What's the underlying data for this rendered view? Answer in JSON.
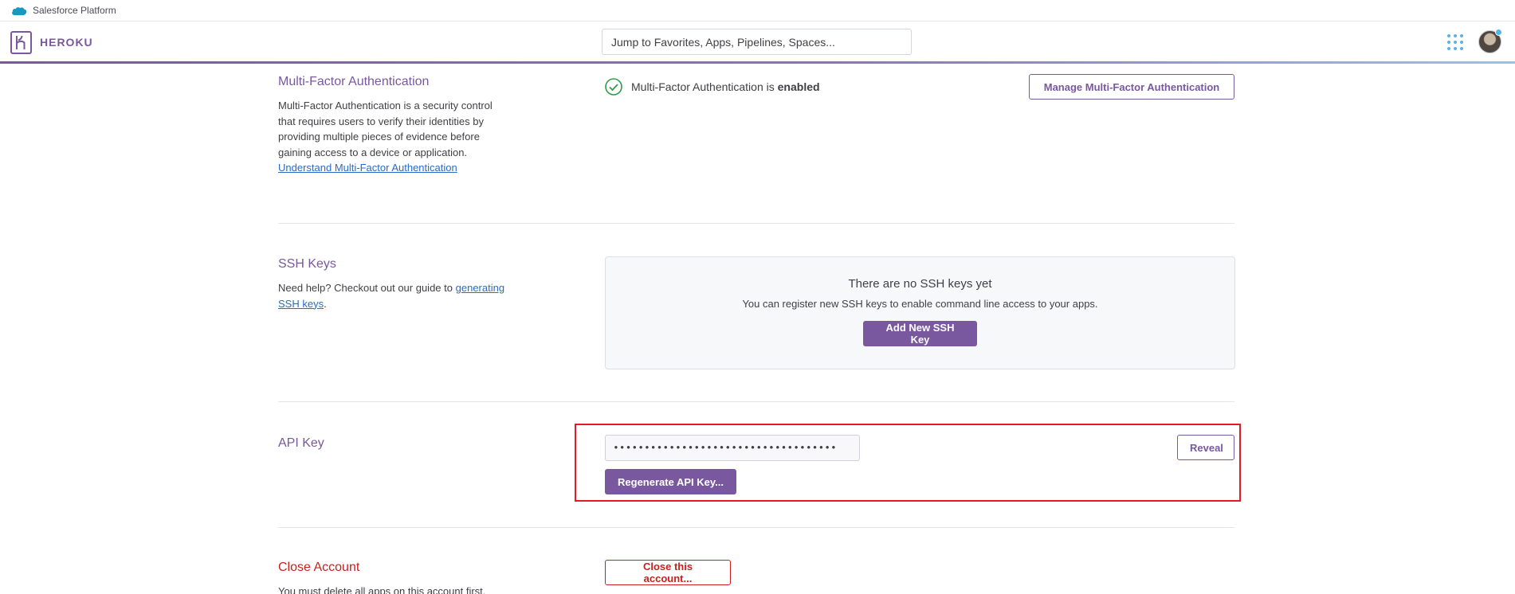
{
  "platform": {
    "label": "Salesforce Platform",
    "icon": "salesforce-cloud-icon",
    "icon_color": "#1798c1"
  },
  "header": {
    "brand": "HEROKU",
    "brand_color": "#79589f",
    "search_placeholder": "Jump to Favorites, Apps, Pipelines, Spaces...",
    "apps_icon": "apps-grid-icon",
    "avatar": "user-avatar"
  },
  "mfa": {
    "title": "Multi-Factor Authentication",
    "description": "Multi-Factor Authentication is a security control that requires users to verify their identities by providing multiple pieces of evidence before gaining access to a device or application.",
    "link_text": "Understand Multi-Factor Authentication",
    "status_prefix": "Multi-Factor Authentication is",
    "status_value": "enabled",
    "status_icon": "check-circle-icon",
    "status_color": "#2e9e44",
    "manage_button": "Manage Multi-Factor Authentication"
  },
  "ssh": {
    "title": "SSH Keys",
    "help_text": "Need help? Checkout out our guide to",
    "help_link": "generating SSH keys",
    "help_suffix": ".",
    "empty_title": "There are no SSH keys yet",
    "empty_desc": "You can register new SSH keys to enable command line access to your apps.",
    "add_button": "Add New SSH Key"
  },
  "api_key": {
    "title": "API Key",
    "masked_value": "••••••••••••••••••••••••••••••••••••",
    "reveal_button": "Reveal",
    "regenerate_button": "Regenerate API Key...",
    "highlight_color": "#e01b24"
  },
  "close_account": {
    "title": "Close Account",
    "description": "You must delete all apps on this account first.",
    "button": "Close this account...",
    "danger_color": "#c8201e"
  }
}
